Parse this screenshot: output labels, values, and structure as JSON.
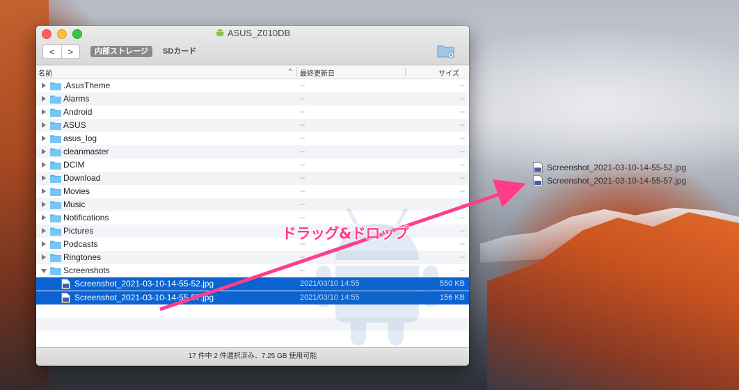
{
  "window": {
    "title": "ASUS_Z010DB",
    "back_label": "<",
    "forward_label": ">",
    "segment_internal": "内部ストレージ",
    "segment_sd": "SDカード"
  },
  "columns": {
    "name": "名前",
    "sort_indicator": "^",
    "modified": "最終更新日",
    "size": "サイズ"
  },
  "folders": [
    {
      "name": ".AsusTheme",
      "date": "--",
      "size": "--"
    },
    {
      "name": "Alarms",
      "date": "--",
      "size": "--"
    },
    {
      "name": "Android",
      "date": "--",
      "size": "--"
    },
    {
      "name": "ASUS",
      "date": "--",
      "size": "--"
    },
    {
      "name": "asus_log",
      "date": "--",
      "size": "--"
    },
    {
      "name": "cleanmaster",
      "date": "--",
      "size": "--"
    },
    {
      "name": "DCIM",
      "date": "--",
      "size": "--"
    },
    {
      "name": "Download",
      "date": "--",
      "size": "--"
    },
    {
      "name": "Movies",
      "date": "--",
      "size": "--"
    },
    {
      "name": "Music",
      "date": "--",
      "size": "--"
    },
    {
      "name": "Notifications",
      "date": "--",
      "size": "--"
    },
    {
      "name": "Pictures",
      "date": "--",
      "size": "--"
    },
    {
      "name": "Podcasts",
      "date": "--",
      "size": "--"
    },
    {
      "name": "Ringtones",
      "date": "--",
      "size": "--"
    },
    {
      "name": "Screenshots",
      "date": "--",
      "size": "--"
    }
  ],
  "files": [
    {
      "name": "Screenshot_2021-03-10-14-55-52.jpg",
      "date": "2021/03/10 14:55",
      "size": "550 KB"
    },
    {
      "name": "Screenshot_2021-03-10-14-55-57.jpg",
      "date": "2021/03/10 14:55",
      "size": "156 KB"
    }
  ],
  "status": "17 件中 2 件選択済み、7.25 GB 使用可能",
  "annotation": "ドラッグ&ドロップ",
  "desktop_files": [
    "Screenshot_2021-03-10-14-55-52.jpg",
    "Screenshot_2021-03-10-14-55-57.jpg"
  ],
  "colors": {
    "selection": "#0a63d1",
    "arrow": "#ff3d8a",
    "folder": "#5fb7f0"
  },
  "icons": [
    "android-icon",
    "folder-icon",
    "new-folder-icon",
    "image-file-icon",
    "disclosure-triangle-icon"
  ]
}
